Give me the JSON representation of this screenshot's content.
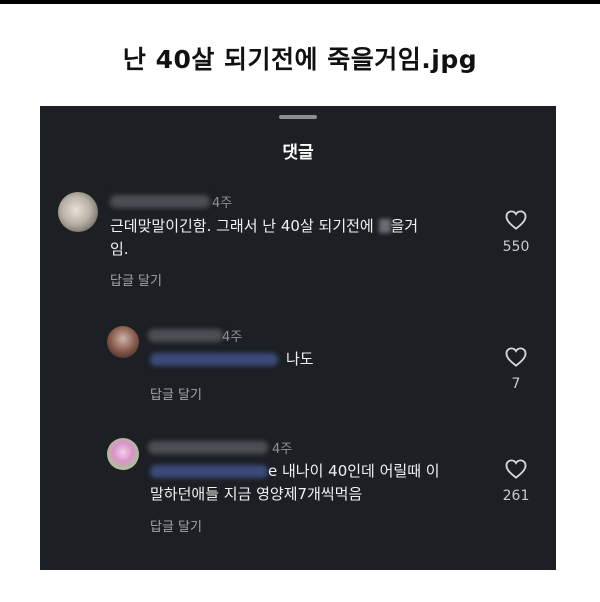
{
  "post": {
    "title": "난 40살 되기전에 죽을거임.jpg"
  },
  "panel": {
    "title": "댓글"
  },
  "comments": [
    {
      "time": "4주",
      "text_line1_a": "근데맞말이긴함. 그래서 난 40살 되기전에 ",
      "text_line1_b": "을거",
      "text_line2": "임.",
      "reply_label": "답글 달기",
      "likes": "550"
    },
    {
      "time": "4주",
      "text": "나도",
      "reply_label": "답글 달기",
      "likes": "7"
    },
    {
      "time": "4주",
      "text_line1": "e 내나이 40인데 어릴때 이",
      "text_line2": "말하던애들 지금 영양제7개씩먹음",
      "reply_label": "답글 달기",
      "likes": "261"
    }
  ],
  "icons": {
    "like": "heart-outline-icon"
  },
  "colors": {
    "panel_bg": "#1c1f24",
    "text": "#f1f1f1",
    "muted": "#8e9196"
  }
}
